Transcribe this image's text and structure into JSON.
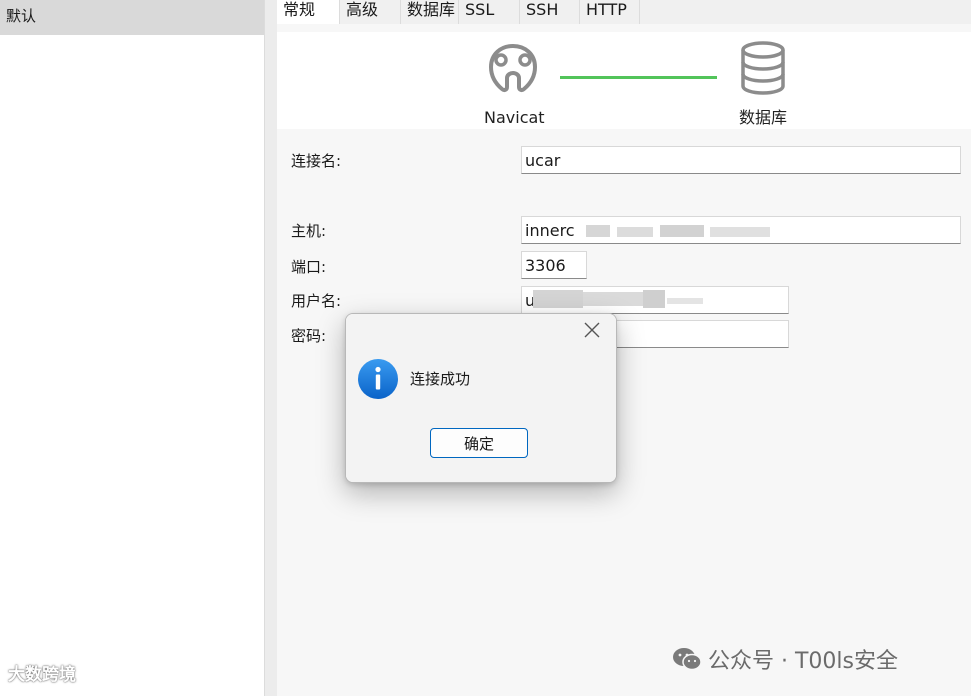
{
  "sidebar": {
    "items": [
      {
        "label": "默认"
      }
    ]
  },
  "tabs": [
    {
      "label": "常规",
      "active": true
    },
    {
      "label": "高级"
    },
    {
      "label": "数据库"
    },
    {
      "label": "SSL"
    },
    {
      "label": "SSH"
    },
    {
      "label": "HTTP"
    }
  ],
  "banner": {
    "app_label": "Navicat",
    "db_label": "数据库",
    "line_color": "#52c45a",
    "app_icon": "navicat-logo-icon",
    "db_icon": "database-icon"
  },
  "form": {
    "connection_name": {
      "label": "连接名:",
      "value": "ucar"
    },
    "host": {
      "label": "主机:",
      "value": "innerc"
    },
    "port": {
      "label": "端口:",
      "value": "3306"
    },
    "username": {
      "label": "用户名:",
      "value": "u"
    },
    "password": {
      "label": "密码:",
      "value": ""
    }
  },
  "dialog": {
    "message": "连接成功",
    "ok_label": "确定",
    "icon": "info-icon",
    "close_icon": "close-icon",
    "accent": "#0067c0"
  },
  "watermarks": {
    "left": "大数跨境",
    "right": "公众号 · T00ls安全",
    "right_icon": "wechat-icon"
  }
}
